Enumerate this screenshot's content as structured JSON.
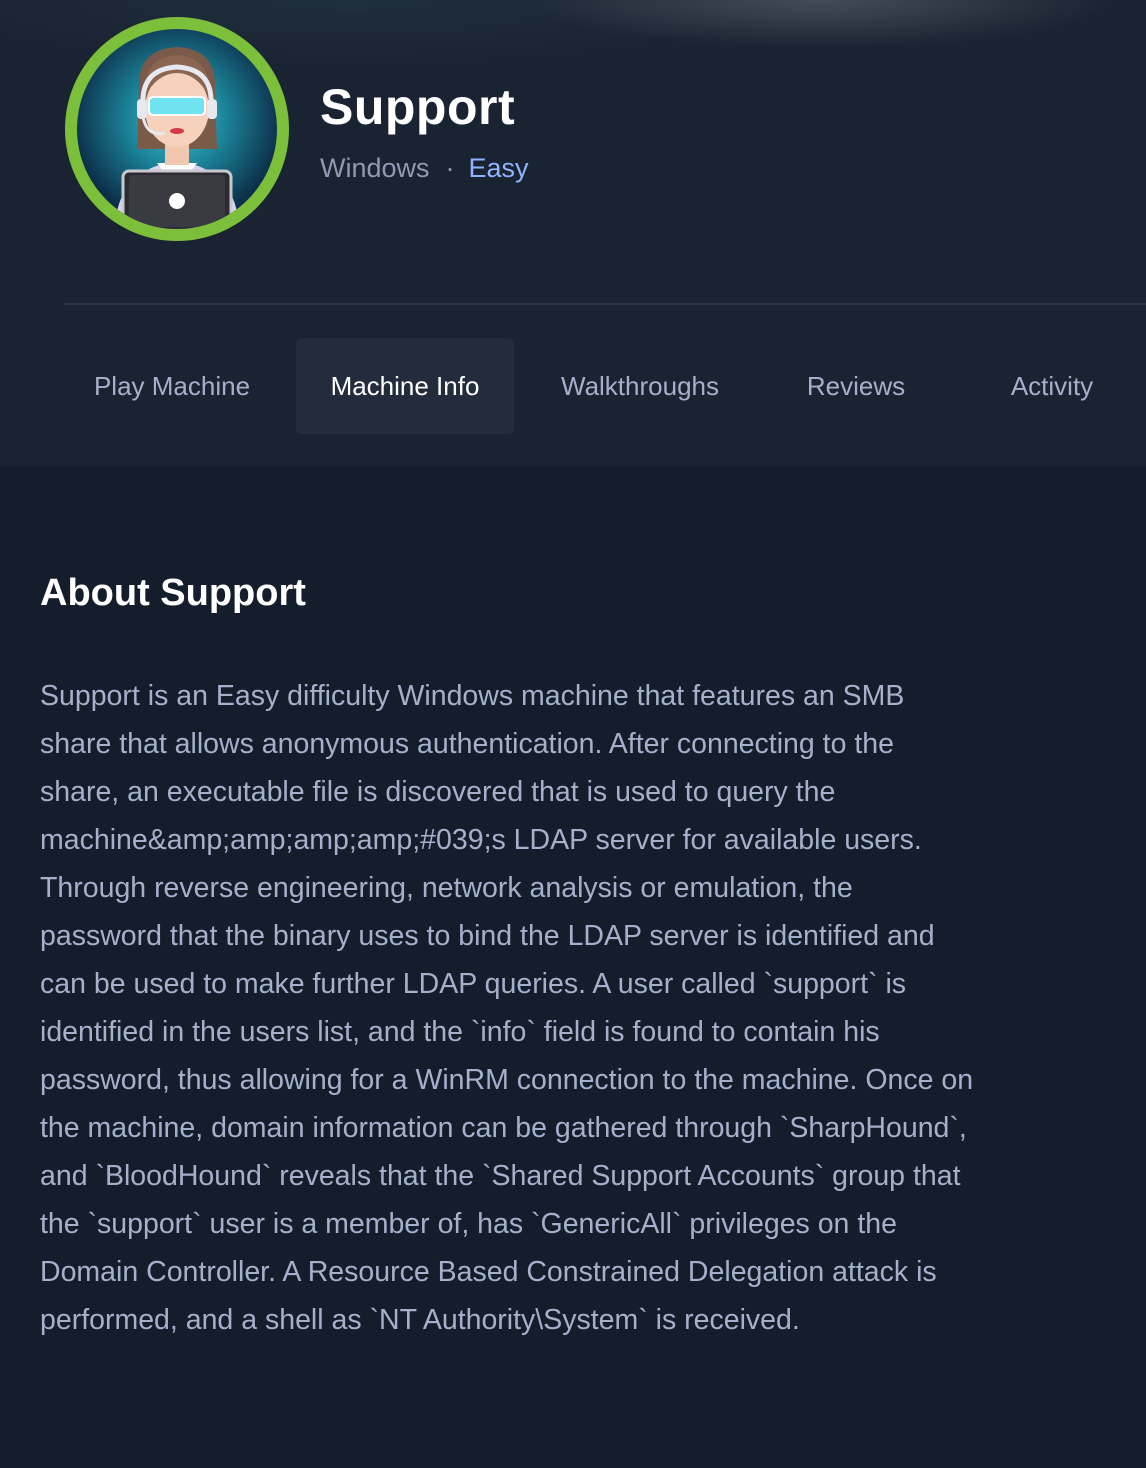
{
  "machine": {
    "name": "Support",
    "os": "Windows",
    "separator": "·",
    "difficulty": "Easy"
  },
  "tabs": [
    {
      "label": "Play Machine"
    },
    {
      "label": "Machine Info",
      "active": true
    },
    {
      "label": "Walkthroughs"
    },
    {
      "label": "Reviews"
    },
    {
      "label": "Activity"
    }
  ],
  "about": {
    "title": "About Support",
    "text": "Support is an Easy difficulty Windows machine that features an SMB share that allows anonymous authentication. After connecting to the share, an executable file is discovered that is used to query the machine&amp;amp;amp;amp;#039;s LDAP server for available users. Through reverse engineering, network analysis or emulation, the password that the binary uses to bind the LDAP server is identified and can be used to make further LDAP queries. A user called `support` is identified in the users list, and the `info` field is found to contain his password, thus allowing for a WinRM connection to the machine. Once on the machine, domain information can be gathered through `SharpHound`, and `BloodHound` reveals that the `Shared Support Accounts` group that the `support` user is a member of, has `GenericAll` privileges on the Domain Controller. A Resource Based Constrained Delegation attack is performed, and a shell as `NT Authority\\System` is received."
  },
  "colors": {
    "background": "#141d2b",
    "header": "#1a2332",
    "avatar_ring": "#7cbf3a",
    "difficulty_easy": "#8fb4ff",
    "text_muted": "#a4b1cd"
  }
}
